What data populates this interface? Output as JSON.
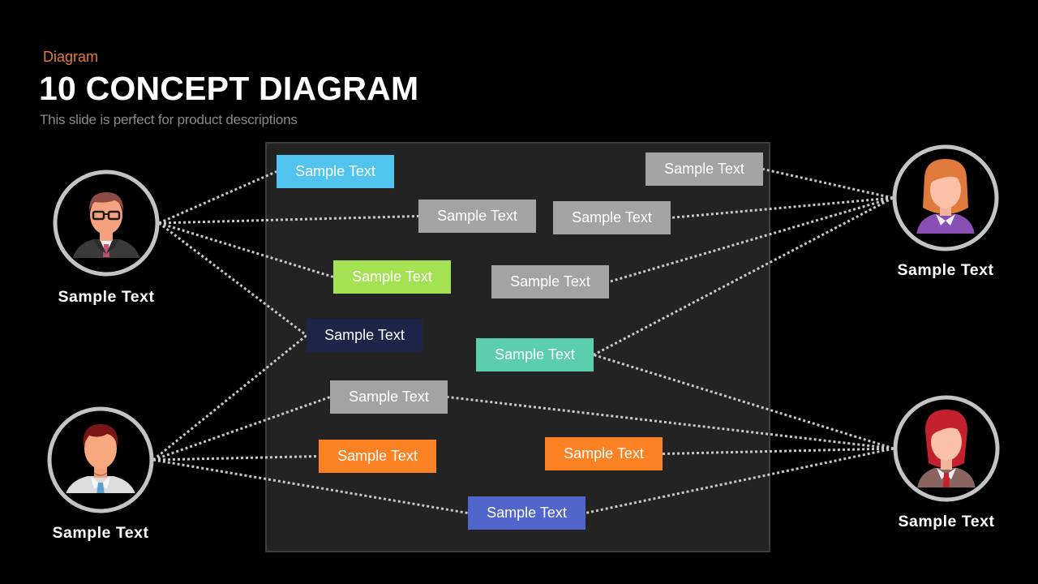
{
  "header": {
    "kicker": "Diagram",
    "title": "10 CONCEPT DIAGRAM",
    "subtitle": "This slide is perfect for product descriptions"
  },
  "nodes": [
    {
      "id": "n1",
      "label": "Sample Text",
      "color": "#50C4EF"
    },
    {
      "id": "n2",
      "label": "Sample Text",
      "color": "#A3A3A3"
    },
    {
      "id": "n3",
      "label": "Sample Text",
      "color": "#A3A3A3"
    },
    {
      "id": "n4",
      "label": "Sample Text",
      "color": "#A3A3A3"
    },
    {
      "id": "n5",
      "label": "Sample Text",
      "color": "#A5E253"
    },
    {
      "id": "n6",
      "label": "Sample Text",
      "color": "#A3A3A3"
    },
    {
      "id": "n7",
      "label": "Sample Text",
      "color": "#1F2548"
    },
    {
      "id": "n8",
      "label": "Sample Text",
      "color": "#5BCFAD"
    },
    {
      "id": "n9",
      "label": "Sample Text",
      "color": "#A3A3A3"
    },
    {
      "id": "n10",
      "label": "Sample Text",
      "color": "#FB8122"
    },
    {
      "id": "n11",
      "label": "Sample Text",
      "color": "#FB8122"
    },
    {
      "id": "n12",
      "label": "Sample Text",
      "color": "#5166CA"
    }
  ],
  "people": [
    {
      "id": "p1",
      "label": "Sample Text",
      "avatar": "man-glasses-suit",
      "side": "left"
    },
    {
      "id": "p2",
      "label": "Sample Text",
      "avatar": "woman-purple-sweater",
      "side": "right"
    },
    {
      "id": "p3",
      "label": "Sample Text",
      "avatar": "man-shirt-tie",
      "side": "left"
    },
    {
      "id": "p4",
      "label": "Sample Text",
      "avatar": "woman-red-hair-suit",
      "side": "right"
    }
  ],
  "connections": [
    [
      "p1",
      "n1"
    ],
    [
      "p1",
      "n3"
    ],
    [
      "p1",
      "n5"
    ],
    [
      "p1",
      "n7"
    ],
    [
      "p3",
      "n7"
    ],
    [
      "p3",
      "n9"
    ],
    [
      "p3",
      "n10"
    ],
    [
      "p3",
      "n12"
    ],
    [
      "p2",
      "n2"
    ],
    [
      "p2",
      "n4"
    ],
    [
      "p2",
      "n6"
    ],
    [
      "p2",
      "n8"
    ],
    [
      "p4",
      "n8"
    ],
    [
      "p4",
      "n9"
    ],
    [
      "p4",
      "n11"
    ],
    [
      "p4",
      "n12"
    ]
  ],
  "colors": {
    "accent": "#E97A3A",
    "ring": "#C4C4C4",
    "link": "#C8C8C8",
    "panel": "#232323"
  }
}
